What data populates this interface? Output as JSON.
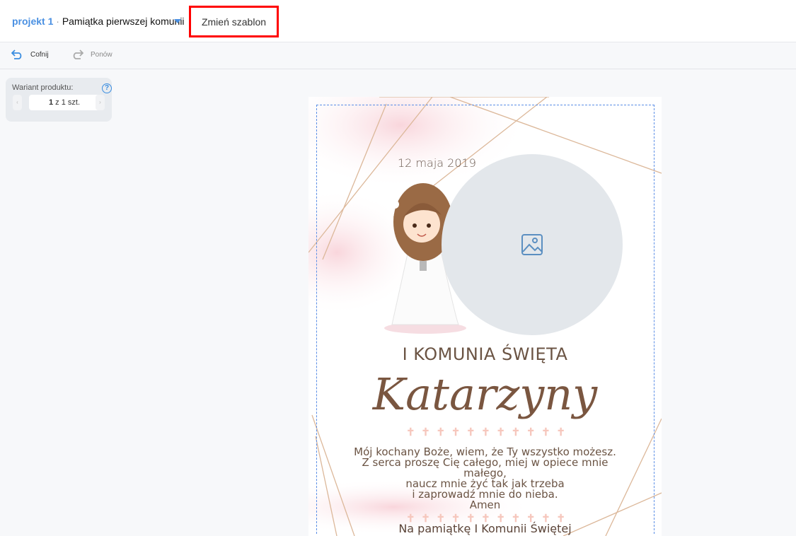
{
  "header": {
    "project": "projekt 1",
    "separator": "·",
    "product": "Pamiątka pierwszej komunii",
    "change_template": "Zmień szablon"
  },
  "toolbar": {
    "undo": "Cofnij",
    "redo": "Ponów"
  },
  "variant": {
    "label": "Wariant produktu:",
    "help": "?",
    "current": "1",
    "of_text": "z 1 szt.",
    "prev": "‹",
    "next": "›"
  },
  "card": {
    "date": "12 maja 2019",
    "title": "I KOMUNIA ŚWIĘTA",
    "name": "Katarzyny",
    "cross": "✝",
    "poem": [
      "Mój kochany Boże, wiem, że Ty wszystko możesz.",
      "Z serca proszę Cię całego, miej w opiece mnie",
      "małego,",
      "naucz mnie żyć tak jak trzeba",
      "i zaprowadź mnie do nieba.",
      "Amen"
    ],
    "footer": "Na pamiątkę I Komunii Świętej"
  },
  "colors": {
    "accent": "#4a90e2",
    "highlight": "#ff0000",
    "text": "#6b5444"
  }
}
